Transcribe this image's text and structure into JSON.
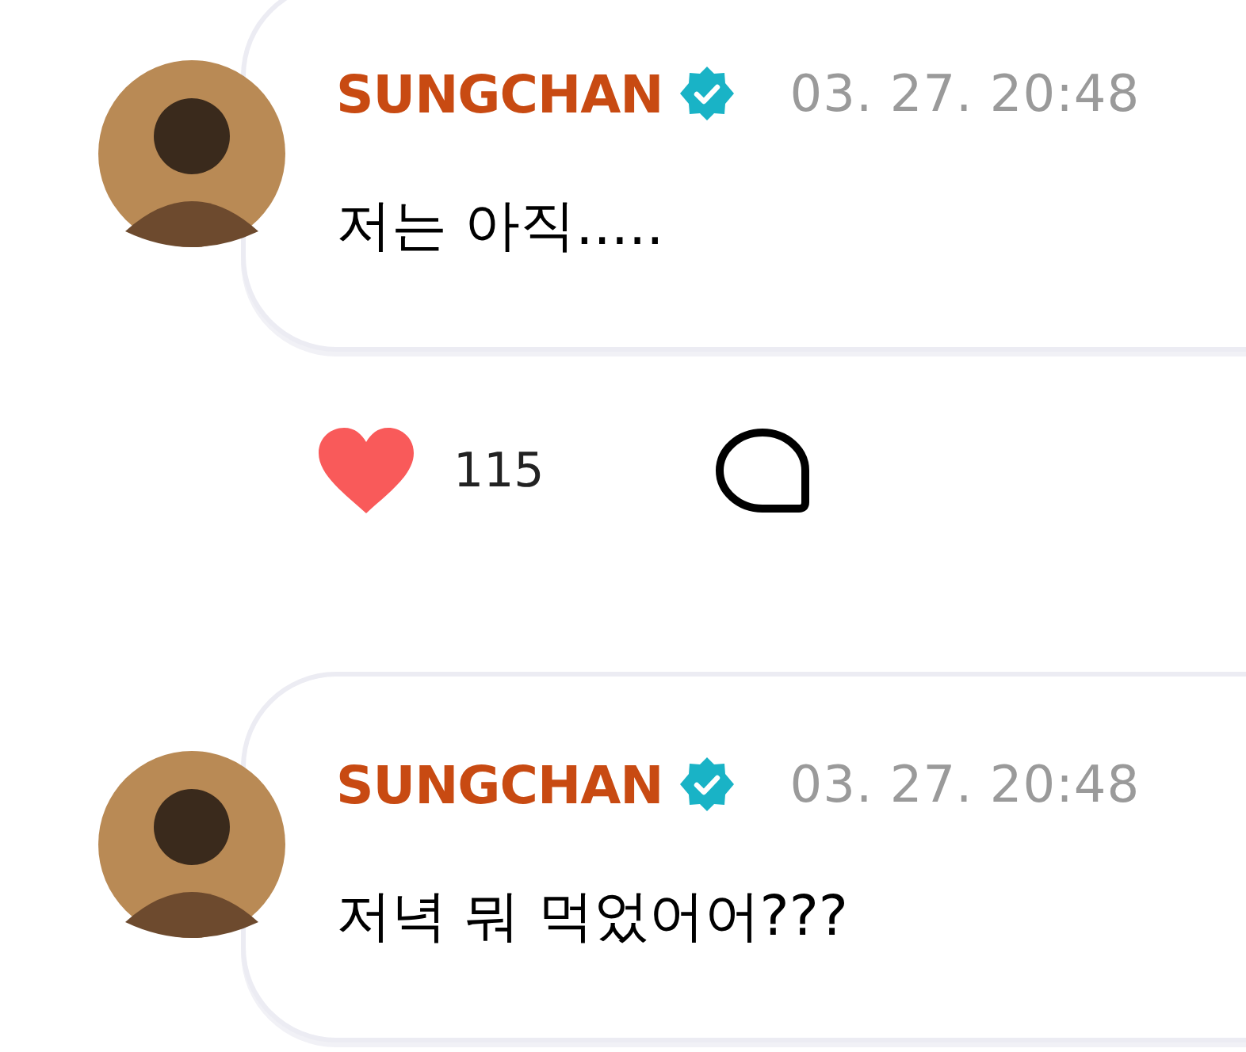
{
  "messages": [
    {
      "author": "SUNGCHAN",
      "verified": true,
      "time": "03. 27. 20:48",
      "text": "저는 아직.....",
      "reactions": {
        "liked": true,
        "likes": "115"
      }
    },
    {
      "author": "SUNGCHAN",
      "verified": true,
      "time": "03. 27. 20:48",
      "text": "저녁 뭐 먹었어어???"
    }
  ]
}
